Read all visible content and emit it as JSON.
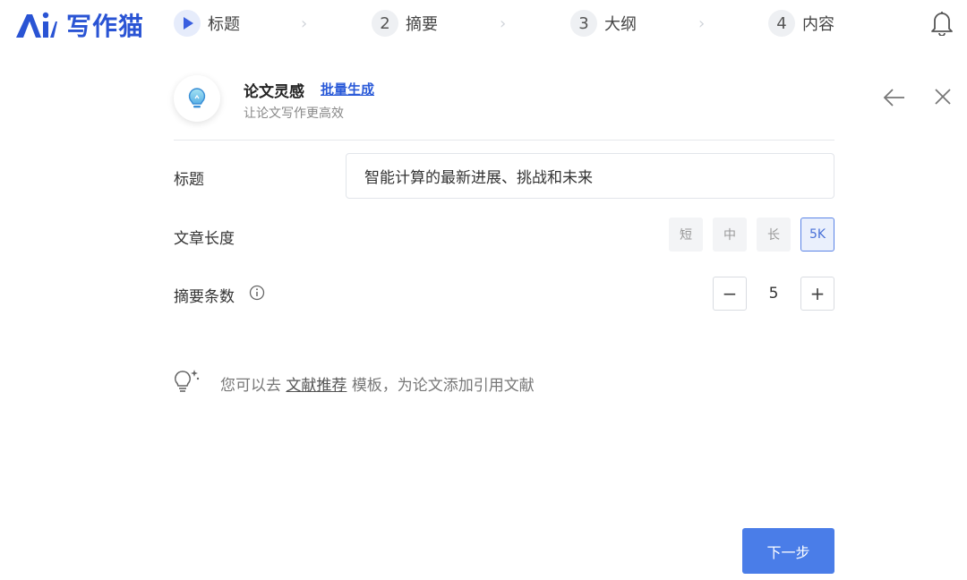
{
  "app": {
    "logo_text": "写作猫",
    "brand_color": "#2a54d4"
  },
  "steps": [
    {
      "number": "",
      "label": "标题",
      "active": true
    },
    {
      "number": "2",
      "label": "摘要",
      "active": false
    },
    {
      "number": "3",
      "label": "大纲",
      "active": false
    },
    {
      "number": "4",
      "label": "内容",
      "active": false
    }
  ],
  "header": {
    "title": "论文灵感",
    "link": "批量生成",
    "subtitle": "让论文写作更高效"
  },
  "form": {
    "title_label": "标题",
    "title_value": "智能计算的最新进展、挑战和未来",
    "length_label": "文章长度",
    "length_options": [
      "短",
      "中",
      "长",
      "5K"
    ],
    "length_selected": "5K",
    "count_label": "摘要条数",
    "count_value": "5",
    "minus": "−",
    "plus": "+"
  },
  "tip": {
    "prefix": "您可以去",
    "link": "文献推荐",
    "suffix": "模板，为论文添加引用文献"
  },
  "footer": {
    "next_label": "下一步",
    "accent": "#4a7de8"
  }
}
